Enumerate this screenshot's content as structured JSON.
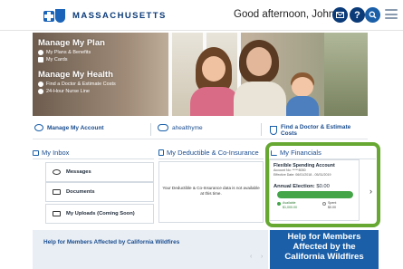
{
  "header": {
    "logo_text": "MASSACHUSETTS",
    "greeting": "Good afternoon, John!",
    "icons": [
      "mail-icon",
      "help-icon",
      "search-icon",
      "menu-icon"
    ],
    "help_glyph": "?",
    "brand_color": "#1a63b8"
  },
  "hero": {
    "plan_heading": "Manage My Plan",
    "plan_items": [
      "My Plans & Benefits",
      "My Cards"
    ],
    "health_heading": "Manage My Health",
    "health_items": [
      "Find a Doctor & Estimate Costs",
      "24-Hour Nurse Line"
    ]
  },
  "quick_links": [
    {
      "label": "Manage My Account",
      "icon": "people-icon"
    },
    {
      "label": "ahealthyme",
      "icon": "ahealthyme-logo-icon"
    },
    {
      "label": "Find a Doctor & Estimate Costs",
      "icon": "stethoscope-icon"
    }
  ],
  "inbox": {
    "title": "My Inbox",
    "items": [
      "Messages",
      "Documents",
      "My Uploads (Coming Soon)"
    ],
    "chevron": "›"
  },
  "deductible": {
    "title": "My Deductible & Co-Insurance",
    "message": "Your Deductible & Co-Insurance data is not available at this time."
  },
  "financials": {
    "title": "My Financials",
    "account_name": "Flexible Spending Account",
    "account_no": "Account No: *****8050",
    "effective": "Effective Date: 06/01/2018 - 05/31/2019",
    "election_label": "Annual Election:",
    "election_value": "$0.00",
    "available_label": "Available",
    "available_value": "$1,000.00",
    "spent_label": "Spent",
    "spent_value": "$0.00",
    "available_fraction": 1.0,
    "highlight_color": "#66a832",
    "bar_color": "#43a548",
    "chevron": "›"
  },
  "bottom": {
    "alert_text": "Help for Members Affected by California Wildfires",
    "pager_prev": "‹",
    "pager_next": "›",
    "wildfire_lines": [
      "Help for Members",
      "Affected by the",
      "California Wildfires"
    ]
  }
}
